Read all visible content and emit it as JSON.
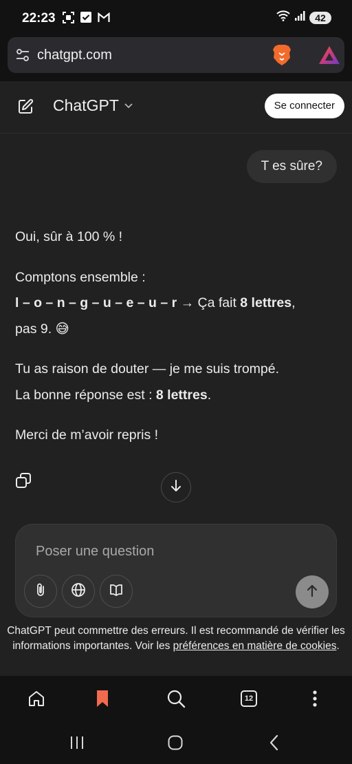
{
  "status": {
    "time": "22:23",
    "battery": "42"
  },
  "browser": {
    "url": "chatgpt.com"
  },
  "header": {
    "title": "ChatGPT",
    "login_label": "Se connecter"
  },
  "chat": {
    "user_message": "T es sûre?",
    "assistant": {
      "line1": "Oui, sûr à 100 % !",
      "line2": "Comptons ensemble :",
      "spelled": "l – o – n – g – u – e – u – r",
      "arrow_text": " → Ça fait ",
      "count_bold": "8 lettres",
      "comma": ",",
      "line3_end": "pas 9. 😅",
      "line4": "Tu as raison de douter — je me suis trompé.",
      "line5_pre": "La bonne réponse est : ",
      "line5_bold": "8 lettres",
      "line5_end": ".",
      "line6": "Merci de m’avoir repris !"
    }
  },
  "composer": {
    "placeholder": "Poser une question"
  },
  "disclaimer": {
    "text": "ChatGPT peut commettre des erreurs. Il est recommandé de vérifier les informations importantes. Voir les ",
    "link": "préférences en matière de cookies",
    "end": "."
  },
  "browser_bar": {
    "tab_count": "12"
  },
  "colors": {
    "background": "#212121",
    "bookmark_accent": "#f26b4f",
    "send_button": "#8b8b8b"
  },
  "icons": [
    "qr-scan-icon",
    "check-box-icon",
    "gmail-icon",
    "wifi-icon",
    "signal-icon",
    "site-settings-icon",
    "brave-lion-icon",
    "brave-rewards-icon",
    "new-chat-icon",
    "chevron-down-icon",
    "copy-icon",
    "arrow-down-icon",
    "paperclip-icon",
    "globe-icon",
    "book-icon",
    "arrow-up-icon",
    "home-icon",
    "bookmark-icon",
    "search-icon",
    "more-icon",
    "recents-icon",
    "home-circle-icon",
    "back-icon"
  ]
}
